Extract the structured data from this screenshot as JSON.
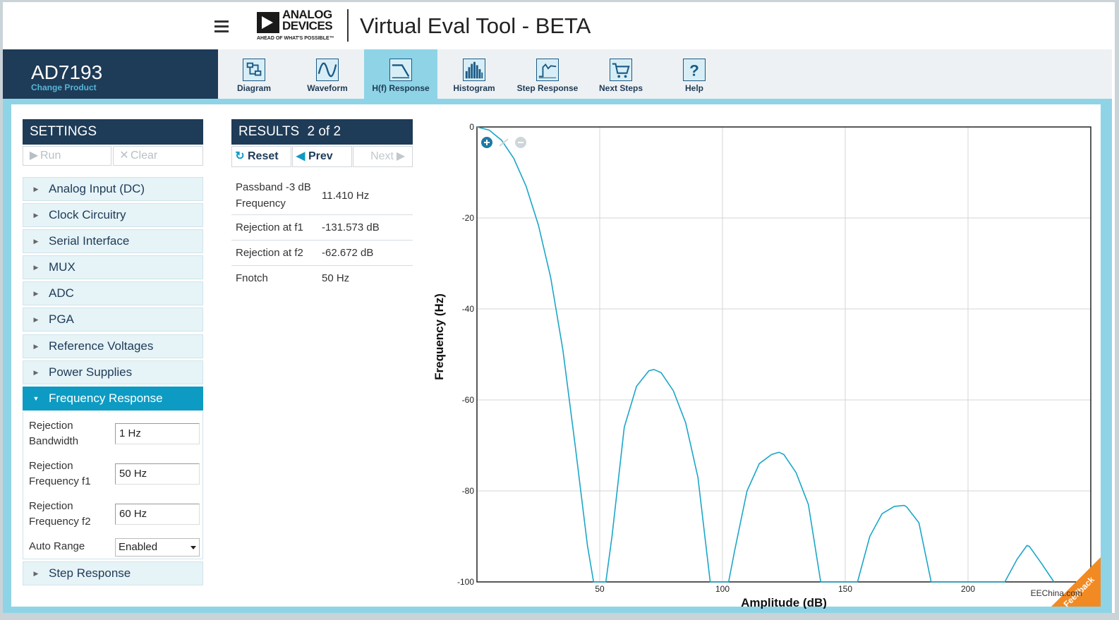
{
  "header": {
    "logo_line1": "ANALOG",
    "logo_line2": "DEVICES",
    "logo_tagline": "AHEAD OF WHAT'S POSSIBLE™",
    "app_title": "Virtual Eval Tool - BETA",
    "menu_icon": "hamburger-icon"
  },
  "product": {
    "name": "AD7193",
    "change_label": "Change Product"
  },
  "nav": {
    "tabs": [
      {
        "label": "Diagram",
        "icon": "diagram-icon",
        "active": false
      },
      {
        "label": "Waveform",
        "icon": "waveform-icon",
        "active": false
      },
      {
        "label": "H(f) Response",
        "icon": "filter-response-icon",
        "active": true
      },
      {
        "label": "Histogram",
        "icon": "histogram-icon",
        "active": false
      },
      {
        "label": "Step Response",
        "icon": "step-response-icon",
        "active": false
      },
      {
        "label": "Next Steps",
        "icon": "cart-icon",
        "active": false
      },
      {
        "label": "Help",
        "icon": "help-icon",
        "active": false
      }
    ]
  },
  "settings": {
    "title": "SETTINGS",
    "run_label": "Run",
    "clear_label": "Clear",
    "sections": [
      {
        "label": "Analog Input (DC)",
        "open": false
      },
      {
        "label": "Clock Circuitry",
        "open": false
      },
      {
        "label": "Serial Interface",
        "open": false
      },
      {
        "label": "MUX",
        "open": false
      },
      {
        "label": "ADC",
        "open": false
      },
      {
        "label": "PGA",
        "open": false
      },
      {
        "label": "Reference Voltages",
        "open": false
      },
      {
        "label": "Power Supplies",
        "open": false
      },
      {
        "label": "Frequency Response",
        "open": true
      },
      {
        "label": "Step Response",
        "open": false
      }
    ],
    "freq_response": {
      "rejection_bandwidth_label_1": "Rejection",
      "rejection_bandwidth_label_2": "Bandwidth",
      "rejection_bandwidth_value": "1 Hz",
      "f1_label_1": "Rejection",
      "f1_label_2": "Frequency f1",
      "f1_value": "50 Hz",
      "f2_label_1": "Rejection",
      "f2_label_2": "Frequency f2",
      "f2_value": "60 Hz",
      "auto_range_label": "Auto Range",
      "auto_range_value": "Enabled"
    }
  },
  "results": {
    "title": "RESULTS",
    "page": "2 of 2",
    "reset_label": "Reset",
    "prev_label": "Prev",
    "next_label": "Next",
    "rows": [
      {
        "label_1": "Passband -3 dB",
        "label_2": "Frequency",
        "value": "11.410 Hz"
      },
      {
        "label_1": "Rejection at f1",
        "label_2": "",
        "value": "-131.573 dB"
      },
      {
        "label_1": "Rejection at f2",
        "label_2": "",
        "value": "-62.672 dB"
      },
      {
        "label_1": "Fnotch",
        "label_2": "",
        "value": "50 Hz"
      }
    ]
  },
  "chart_data": {
    "type": "line",
    "title": "",
    "xlabel": "Amplitude (dB)",
    "ylabel": "Frequency (Hz)",
    "xlim": [
      0,
      250
    ],
    "ylim": [
      -100,
      0
    ],
    "x_ticks": [
      50,
      100,
      150,
      200
    ],
    "y_ticks": [
      0,
      -20,
      -40,
      -60,
      -80,
      -100
    ],
    "grid": true,
    "color": "#1ba6c9",
    "series": [
      {
        "x": [
          0,
          5,
          10,
          15,
          20,
          25,
          30,
          35,
          40,
          45,
          47.5,
          50,
          52.5,
          55,
          60,
          65,
          70,
          72,
          75,
          80,
          85,
          90,
          95,
          97.5,
          100,
          102.5,
          105,
          110,
          115,
          120,
          123,
          125,
          130,
          135,
          140,
          145,
          147.5,
          150,
          152.5,
          155,
          160,
          165,
          170,
          174,
          175,
          180,
          185,
          190,
          195,
          197.5,
          200,
          202.5,
          205,
          210,
          215,
          220,
          224,
          225,
          230,
          235
        ],
        "y": [
          0,
          -0.7,
          -2.9,
          -6.9,
          -13,
          -21.5,
          -33,
          -49,
          -70,
          -92,
          -100,
          -100,
          -100,
          -90,
          -66,
          -57,
          -53.6,
          -53.3,
          -54,
          -58,
          -65,
          -77,
          -100,
          -100,
          -100,
          -100,
          -93,
          -80,
          -74,
          -72,
          -71.5,
          -72,
          -76,
          -83,
          -100,
          -100,
          -100,
          -100,
          -100,
          -100,
          -90,
          -85,
          -83.4,
          -83.2,
          -83.5,
          -87,
          -100,
          -100,
          -100,
          -100,
          -100,
          -100,
          -100,
          -100,
          -100,
          -95,
          -92,
          -92.2,
          -96,
          -100
        ]
      }
    ],
    "zoom_controls": {
      "zoom_in": "zoom-in-icon",
      "reset": "zoom-reset-icon",
      "zoom_out": "zoom-out-icon"
    }
  },
  "footer": {
    "feedback_label": "Feedback",
    "watermark": "EEChina.com"
  }
}
